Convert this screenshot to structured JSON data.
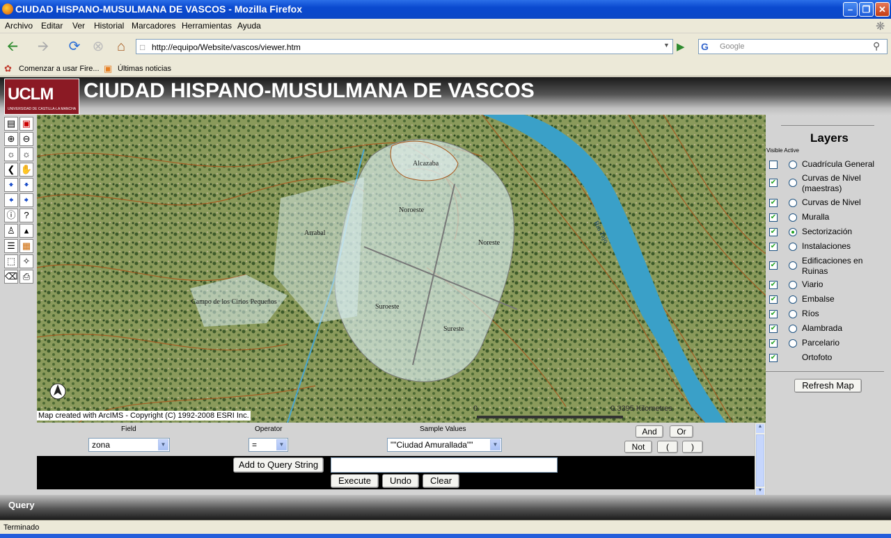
{
  "window": {
    "title": "CIUDAD HISPANO-MUSULMANA DE VASCOS - Mozilla Firefox"
  },
  "menu": [
    "Archivo",
    "Editar",
    "Ver",
    "Historial",
    "Marcadores",
    "Herramientas",
    "Ayuda"
  ],
  "nav": {
    "url": "http://equipo/Website/vascos/viewer.htm",
    "search_placeholder": "Google"
  },
  "bookmarks": [
    "Comenzar a usar Fire...",
    "Últimas noticias"
  ],
  "app": {
    "logo_text": "UCLM",
    "logo_subtext": "UNIVERSIDAD DE CASTILLA-LA MANCHA",
    "title": "CIUDAD HISPANO-MUSULMANA DE VASCOS"
  },
  "map": {
    "copyright": "Map created with ArcIMS - Copyright (C) 1992-2008 ESRI Inc.",
    "scale_zero": "0",
    "scale_label": "0.3395 Kilometres",
    "labels": [
      "Alcazaba",
      "Noroeste",
      "Arrabal",
      "Noreste",
      "Campo de los Cirios Pequeños",
      "Suroeste",
      "Sureste",
      "Río Tajo"
    ]
  },
  "layers": {
    "title": "Layers",
    "header": "Visible Active",
    "items": [
      {
        "name": "Cuadrícula General",
        "visible": false,
        "active": false
      },
      {
        "name": "Curvas de Nivel (maestras)",
        "visible": true,
        "active": false
      },
      {
        "name": "Curvas de Nivel",
        "visible": true,
        "active": false
      },
      {
        "name": "Muralla",
        "visible": true,
        "active": false
      },
      {
        "name": "Sectorización",
        "visible": true,
        "active": true
      },
      {
        "name": "Instalaciones",
        "visible": true,
        "active": false
      },
      {
        "name": "Edificaciones en Ruinas",
        "visible": true,
        "active": false
      },
      {
        "name": "Viario",
        "visible": true,
        "active": false
      },
      {
        "name": "Embalse",
        "visible": true,
        "active": false
      },
      {
        "name": "Ríos",
        "visible": true,
        "active": false
      },
      {
        "name": "Alambrada",
        "visible": true,
        "active": false
      },
      {
        "name": "Parcelario",
        "visible": true,
        "active": false
      },
      {
        "name": "Ortofoto",
        "visible": true,
        "active": null
      }
    ],
    "refresh_label": "Refresh Map"
  },
  "query": {
    "field_label": "Field",
    "field_value": "zona",
    "operator_label": "Operator",
    "operator_value": "=",
    "sample_label": "Sample Values",
    "sample_value": "\"\"Ciudad Amurallada\"\"",
    "and_label": "And",
    "or_label": "Or",
    "not_label": "Not",
    "lparen_label": "(",
    "rparen_label": ")",
    "add_label": "Add to Query String",
    "query_string": "",
    "execute_label": "Execute",
    "undo_label": "Undo",
    "clear_label": "Clear",
    "panel_title": "Query"
  },
  "status": {
    "text": "Terminado"
  }
}
